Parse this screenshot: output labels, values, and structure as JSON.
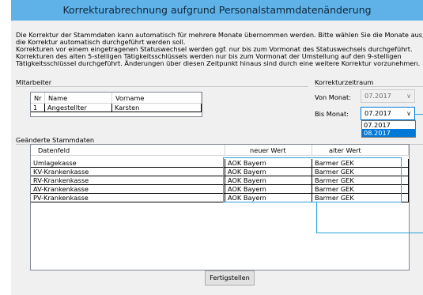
{
  "window": {
    "title": "Korrekturabrechnung aufgrund Personalstammdatenänderung"
  },
  "info_lines": [
    "Die Korrektur der Stammdaten kann automatisch für mehrere Monate übernommen werden. Bitte wählen Sie die Monate aus, für die",
    "die Korrektur automatisch durchgeführt werden soll.",
    "Korrekturen vor einem eingetragenen Statuswechsel werden ggf. nur bis zum Vormonat des Statuswechsels durchgeführt.",
    "Korrekturen des alten 5-stelligen Tätigkeitsschlüssels werden nur bis zum Vormonat der Umstellung auf den 9-stelligen",
    "Tätigkeitsschlüssel durchgeführt. Änderungen über diesen Zeitpunkt hinaus sind durch eine weitere Korrektur vorzunehmen."
  ],
  "mitarbeiter": {
    "label": "Mitarbeiter",
    "columns": [
      "Nr",
      "Name",
      "Vorname"
    ],
    "row": [
      "1",
      "Angestellter",
      "Karsten"
    ]
  },
  "zeitraum": {
    "label": "Korrekturzeitraum",
    "von_label": "Von Monat:",
    "von_value": "07.2017",
    "bis_label": "Bis Monat:",
    "bis_value": "07.2017",
    "options": [
      "07.2017",
      "08.2017"
    ],
    "highlighted_option": "08.2017"
  },
  "stammdaten": {
    "label": "Geänderte Stammdaten",
    "columns": [
      "Datenfeld",
      "neuer Wert",
      "alter Wert"
    ],
    "rows": [
      [
        "Umlagekasse",
        "AOK Bayern",
        "Barmer GEK"
      ],
      [
        "KV-Krankenkasse",
        "AOK Bayern",
        "Barmer GEK"
      ],
      [
        "RV-Krankenkasse",
        "AOK Bayern",
        "Barmer GEK"
      ],
      [
        "AV-Krankenkasse",
        "AOK Bayern",
        "Barmer GEK"
      ],
      [
        "PV-Krankenkasse",
        "AOK Bayern",
        "Barmer GEK"
      ]
    ]
  },
  "actions": {
    "finish_label": "Fertigstellen"
  },
  "colors": {
    "titlebar": "#5fb2e8",
    "selection": "#0078d7",
    "highlight": "#2a9fd8"
  }
}
